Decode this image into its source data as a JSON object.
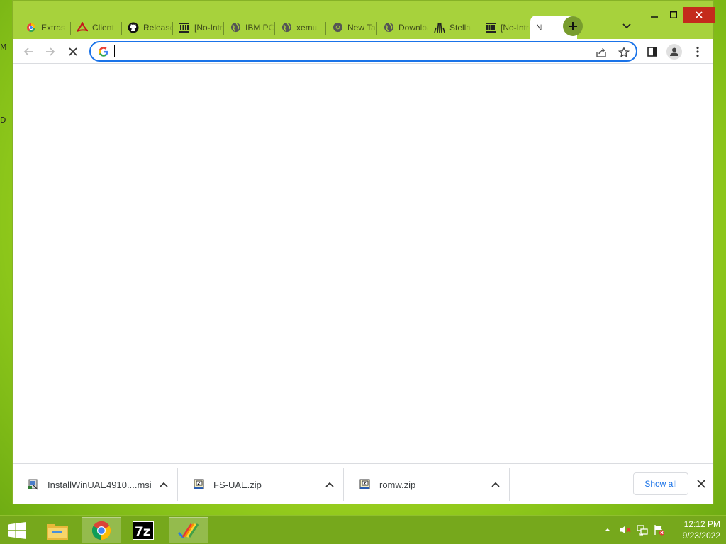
{
  "desktop": {
    "edge_label_top": "M",
    "edge_label_mid": "D"
  },
  "tabs": [
    {
      "title": "Extras",
      "icon": "chrome-web-store-icon",
      "color": "#e8453c"
    },
    {
      "title": "Client",
      "icon": "acrobat-icon",
      "color": "#c4161c"
    },
    {
      "title": "Releases",
      "icon": "github-icon",
      "color": "#111111"
    },
    {
      "title": "[No-Intro]",
      "icon": "archive-org-icon",
      "color": "#222222"
    },
    {
      "title": "IBM PC",
      "icon": "globe-icon",
      "color": "#444444"
    },
    {
      "title": "xemu",
      "icon": "globe-icon",
      "color": "#444444"
    },
    {
      "title": "New Tab",
      "icon": "chrome-icon",
      "color": "#444444"
    },
    {
      "title": "Downloads",
      "icon": "globe-icon",
      "color": "#444444"
    },
    {
      "title": "Stella",
      "icon": "stella-icon",
      "color": "#222222"
    },
    {
      "title": "[No-Intro]",
      "icon": "archive-org-icon",
      "color": "#222222"
    }
  ],
  "active_tab": {
    "title": "N",
    "close_label": "×"
  },
  "toolbar": {
    "omnibox_value": "",
    "omnibox_placeholder": ""
  },
  "downloads": [
    {
      "name": "InstallWinUAE4910....msi",
      "icon": "msi-installer-icon"
    },
    {
      "name": "FS-UAE.zip",
      "icon": "7zip-archive-icon"
    },
    {
      "name": "romw.zip",
      "icon": "7zip-archive-icon"
    }
  ],
  "shelf": {
    "show_all_label": "Show all"
  },
  "clock": {
    "time": "12:12 PM",
    "date": "9/23/2022"
  },
  "colors": {
    "accent": "#1a73e8",
    "window_frame": "#a7d23c",
    "taskbar": "#76a81c"
  }
}
